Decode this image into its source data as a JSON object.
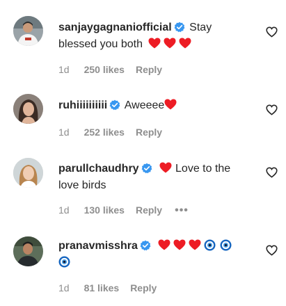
{
  "comments": [
    {
      "username": "sanjaygagnaniofficial",
      "verified": true,
      "text": "Stay blessed you both",
      "emojis_after": [
        "red-heart",
        "red-heart",
        "red-heart"
      ],
      "time": "1d",
      "likes": "250 likes",
      "reply": "Reply"
    },
    {
      "username": "ruhiiiiiiiiii",
      "verified": true,
      "text": "Aweeee",
      "emojis_after": [
        "red-heart"
      ],
      "time": "1d",
      "likes": "252 likes",
      "reply": "Reply"
    },
    {
      "username": "parullchaudhry",
      "verified": true,
      "emojis_before": [
        "red-heart"
      ],
      "text": "Love to the love birds",
      "time": "1d",
      "likes": "130 likes",
      "reply": "Reply",
      "more": "•••"
    },
    {
      "username": "pranavmisshra",
      "verified": true,
      "emojis_after": [
        "red-heart",
        "red-heart",
        "red-heart",
        "nazar-amulet",
        "nazar-amulet",
        "nazar-amulet"
      ],
      "time": "1d",
      "likes": "81 likes",
      "reply": "Reply"
    }
  ],
  "colors": {
    "text": "#262626",
    "meta": "#8e8e8e",
    "verified": "#3897f0",
    "heart": "#ed1c24",
    "nazar": "#1565c0"
  }
}
